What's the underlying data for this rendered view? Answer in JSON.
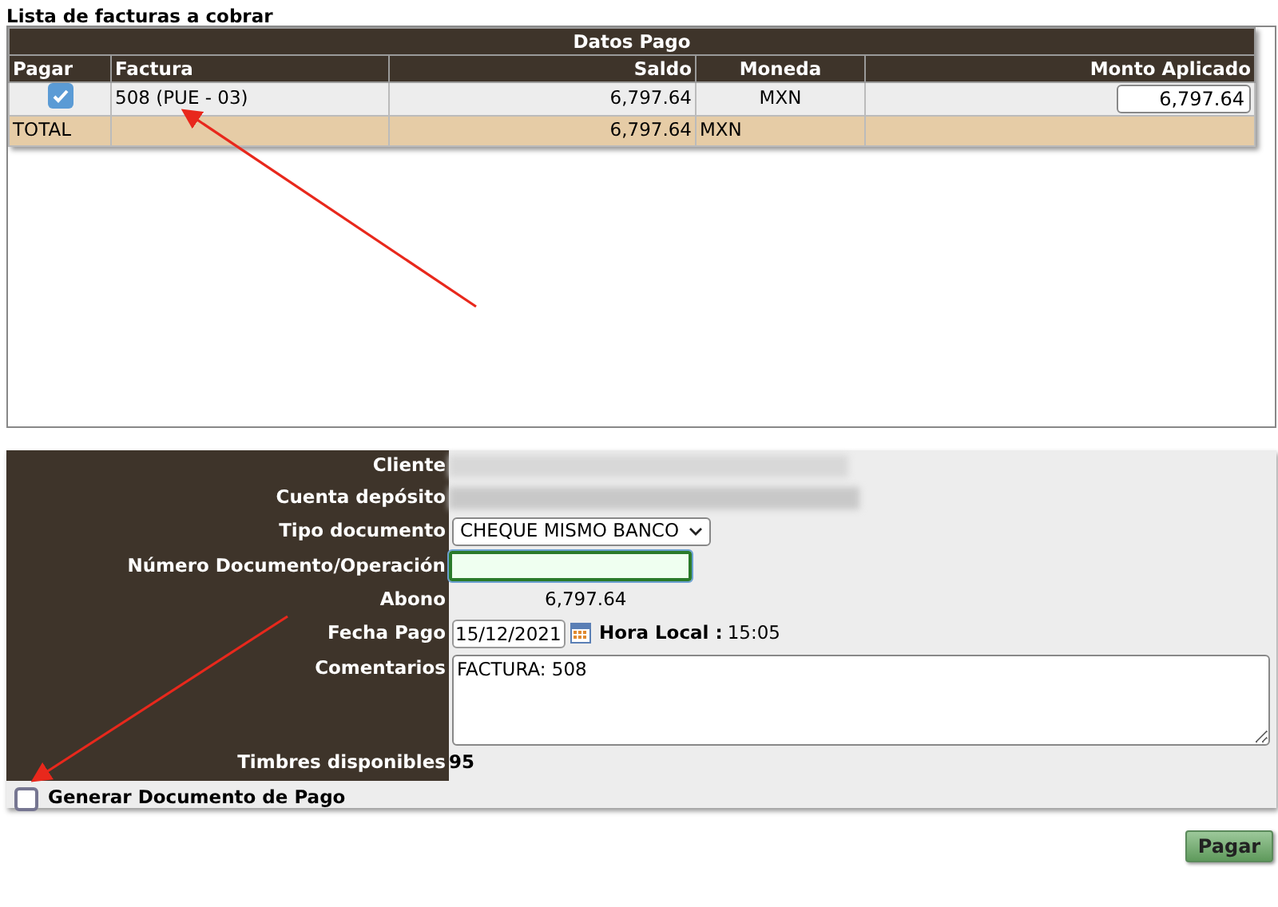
{
  "section_title": "Lista de facturas a cobrar",
  "table": {
    "group_header": "Datos Pago",
    "columns": [
      "Pagar",
      "Factura",
      "Saldo",
      "Moneda",
      "Monto Aplicado"
    ],
    "rows": [
      {
        "checked": true,
        "factura": "508 (PUE - 03)",
        "saldo": "6,797.64",
        "moneda": "MXN",
        "monto_aplicado": "6,797.64"
      }
    ],
    "total": {
      "label": "TOTAL",
      "saldo": "6,797.64",
      "moneda": "MXN"
    }
  },
  "form": {
    "cliente_label": "Cliente",
    "cuenta_label": "Cuenta depósito",
    "tipo_label": "Tipo documento",
    "tipo_value": "CHEQUE MISMO BANCO",
    "numero_label": "Número Documento/Operación",
    "abono_label": "Abono",
    "abono_value": "6,797.64",
    "fecha_label": "Fecha Pago",
    "fecha_value": "15/12/2021",
    "hora_label": "Hora Local :",
    "hora_value": "15:05",
    "comentarios_label": "Comentarios",
    "comentarios_value": "FACTURA: 508",
    "timbres_label": "Timbres disponibles",
    "timbres_value": "95",
    "generar": {
      "label": "Generar Documento de Pago",
      "checked": false
    }
  },
  "pay_button": "Pagar"
}
